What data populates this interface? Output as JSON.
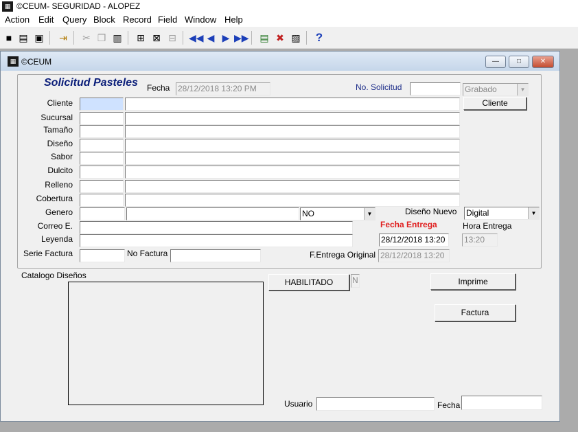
{
  "app": {
    "title": "©CEUM- SEGURIDAD - ALOPEZ",
    "menu": [
      "Action",
      "Edit",
      "Query",
      "Block",
      "Record",
      "Field",
      "Window",
      "Help"
    ]
  },
  "toolbar": {
    "icons": [
      "save-icon",
      "print-icon",
      "print-setup-icon",
      "exit-icon",
      "cut-icon",
      "copy-icon",
      "paste-icon",
      "enter-query-icon",
      "execute-query-icon",
      "cancel-query-icon",
      "first-record-icon",
      "previous-record-icon",
      "next-record-icon",
      "last-record-icon",
      "insert-record-icon",
      "delete-record-icon",
      "lock-record-icon",
      "help-icon"
    ],
    "help_glyph": "?"
  },
  "window": {
    "title": "©CEUM",
    "controls": {
      "minimize": "—",
      "maximize": "□",
      "close": "✕"
    }
  },
  "form": {
    "title": "Solicitud Pasteles",
    "fecha_label": "Fecha",
    "fecha_value": "28/12/2018 13:20 PM",
    "no_solicitud_label": "No. Solicitud",
    "no_solicitud_value": "",
    "status_value": "Grabado",
    "cliente_button": "Cliente",
    "rows": [
      {
        "label": "Cliente",
        "code": "",
        "desc": ""
      },
      {
        "label": "Sucursal",
        "code": "",
        "desc": ""
      },
      {
        "label": "Tamaño",
        "code": "",
        "desc": ""
      },
      {
        "label": "Diseño",
        "code": "",
        "desc": ""
      },
      {
        "label": "Sabor",
        "code": "",
        "desc": ""
      },
      {
        "label": "Dulcito",
        "code": "",
        "desc": ""
      },
      {
        "label": "Relleno",
        "code": "",
        "desc": ""
      },
      {
        "label": "Cobertura",
        "code": "",
        "desc": ""
      }
    ],
    "genero_label": "Genero",
    "genero_code": "",
    "genero_desc": "",
    "genero_select": "NO",
    "diseno_nuevo_label": "Diseño Nuevo",
    "diseno_nuevo_value": "Digital",
    "correo_label": "Correo E.",
    "correo_value": "",
    "fecha_entrega_label": "Fecha Entrega",
    "hora_entrega_label": "Hora Entrega",
    "leyenda_label": "Leyenda",
    "leyenda_value": "",
    "fecha_entrega_value": "28/12/2018 13:20",
    "hora_entrega_value": "13:20",
    "serie_factura_label": "Serie Factura",
    "serie_factura_value": "",
    "no_factura_label": "No Factura",
    "no_factura_value": "",
    "f_entrega_original_label": "F.Entrega Original",
    "f_entrega_original_value": "28/12/2018 13:20"
  },
  "bottom": {
    "catalogo_label": "Catalogo Diseños",
    "habilitado_button": "HABILITADO",
    "habilitado_flag": "N",
    "imprime_button": "Imprime",
    "factura_button": "Factura",
    "usuario_label": "Usuario",
    "usuario_value": "",
    "fecha_label": "Fecha",
    "fecha_value": ""
  },
  "colors": {
    "title_blue": "#0c1f7a",
    "label_navy": "#1b2b88",
    "fecha_entrega_red": "#e02020",
    "focus_field": "#cfe2ff"
  }
}
